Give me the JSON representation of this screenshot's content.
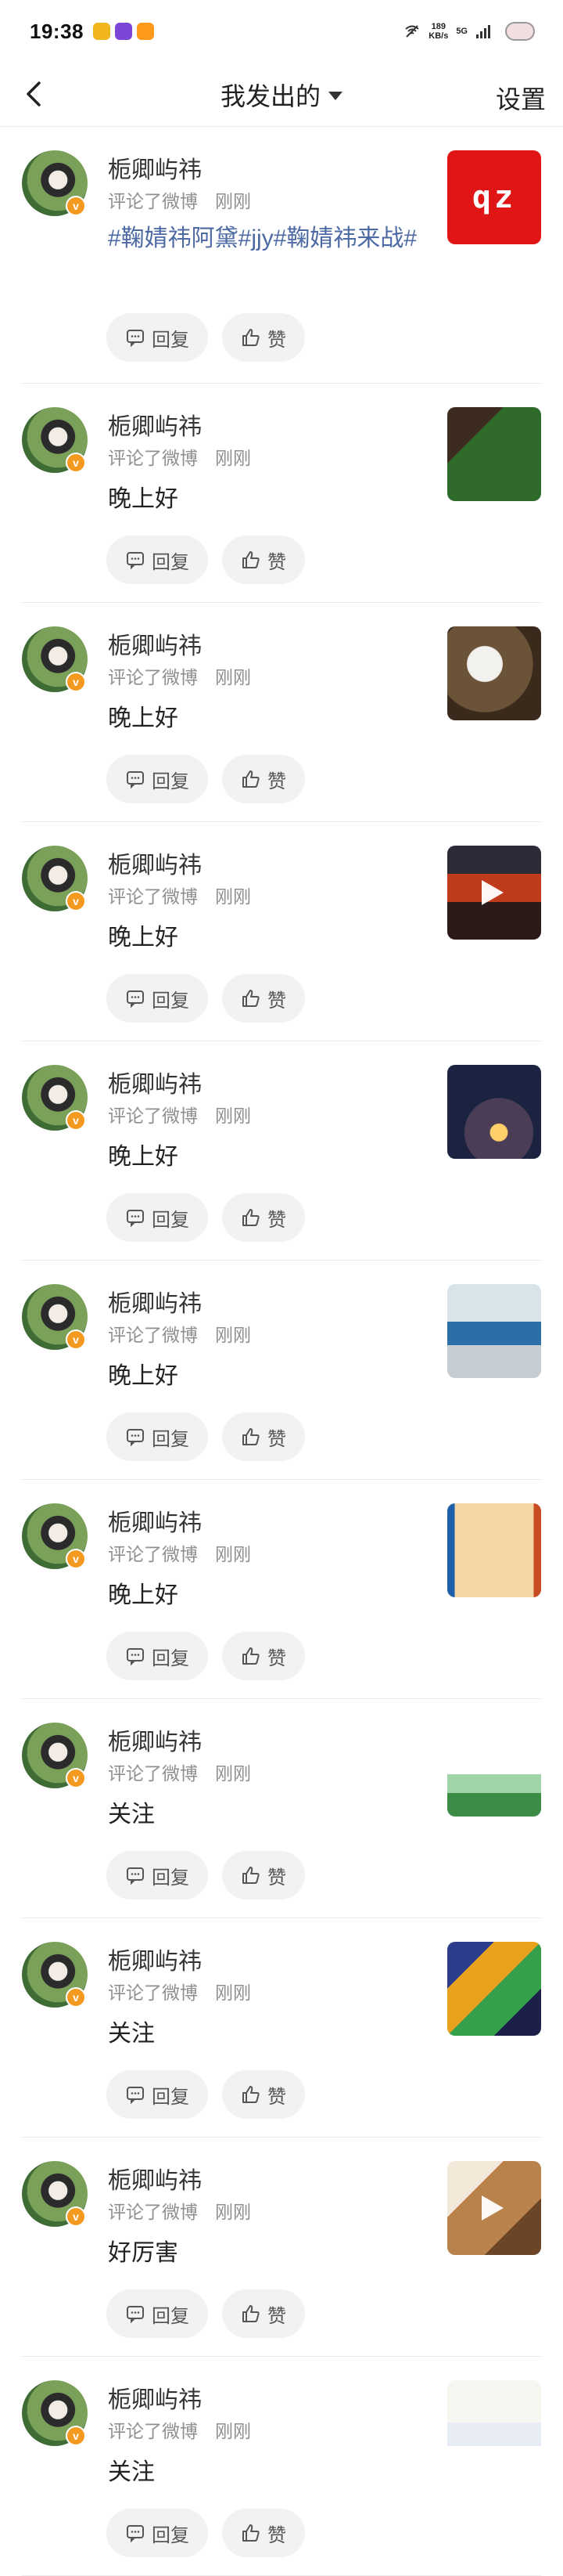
{
  "status_bar": {
    "time": "19:38",
    "net_speed": "189",
    "net_unit": "KB/s",
    "network": "5G"
  },
  "nav": {
    "title": "我发出的",
    "settings": "设置"
  },
  "actions": {
    "reply": "回复",
    "like": "赞"
  },
  "items": [
    {
      "name": "栀卿屿祎",
      "action": "评论了微博",
      "time": "刚刚",
      "comment": "#鞠婧祎阿黛#jjy#鞠婧祎来战#",
      "thumb": "qz-icon",
      "thumb_text": "qz"
    },
    {
      "name": "栀卿屿祎",
      "action": "评论了微博",
      "time": "刚刚",
      "comment": "晚上好",
      "thumb": "red-wall-tree-photo"
    },
    {
      "name": "栀卿屿祎",
      "action": "评论了微博",
      "time": "刚刚",
      "comment": "晚上好",
      "thumb": "street-food-steam-photo"
    },
    {
      "name": "栀卿屿祎",
      "action": "评论了微博",
      "time": "刚刚",
      "comment": "晚上好",
      "thumb": "sunset-city-video"
    },
    {
      "name": "栀卿屿祎",
      "action": "评论了微博",
      "time": "刚刚",
      "comment": "晚上好",
      "thumb": "lantern-night-photo"
    },
    {
      "name": "栀卿屿祎",
      "action": "评论了微博",
      "time": "刚刚",
      "comment": "晚上好",
      "thumb": "factory-worker-photo"
    },
    {
      "name": "栀卿屿祎",
      "action": "评论了微博",
      "time": "刚刚",
      "comment": "晚上好",
      "thumb": "beige-card-image"
    },
    {
      "name": "栀卿屿祎",
      "action": "评论了微博",
      "time": "刚刚",
      "comment": "关注",
      "thumb": "green-banner-image"
    },
    {
      "name": "栀卿屿祎",
      "action": "评论了微博",
      "time": "刚刚",
      "comment": "关注",
      "thumb": "colorful-poster-image"
    },
    {
      "name": "栀卿屿祎",
      "action": "评论了微博",
      "time": "刚刚",
      "comment": "好厉害",
      "thumb": "wood-craft-video"
    },
    {
      "name": "栀卿屿祎",
      "action": "评论了微博",
      "time": "刚刚",
      "comment": "关注",
      "thumb": "flood-travel-poster"
    }
  ],
  "colors": {
    "topic": "#4d6aa4",
    "badge": "#f49a20",
    "divider": "#ebebeb"
  }
}
